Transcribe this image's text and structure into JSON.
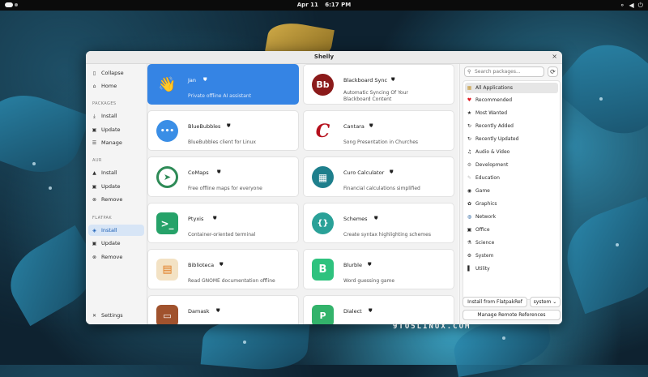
{
  "topbar": {
    "date": "Apr 11",
    "time": "6:17 PM"
  },
  "window": {
    "title": "Shelly",
    "close": "×"
  },
  "sidebar": {
    "collapse": "Collapse",
    "home": "Home",
    "packages_head": "PACKAGES",
    "packages": [
      "Install",
      "Update",
      "Manage"
    ],
    "aur_head": "AUR",
    "aur": [
      "Install",
      "Update",
      "Remove"
    ],
    "flatpak_head": "FLATPAK",
    "flatpak": [
      "Install",
      "Update",
      "Remove"
    ],
    "settings": "Settings"
  },
  "apps": [
    {
      "name": "Jan",
      "desc": "Private offline AI assistant",
      "icon": "waving-hand-icon",
      "color": "#f3c63f"
    },
    {
      "name": "Blackboard Sync",
      "desc": "Automatic Syncing Of Your Blackboard Content",
      "icon": "bb-logo-icon",
      "color": "#2b2b2b"
    },
    {
      "name": "BlueBubbles",
      "desc": "BlueBubbles client for Linux",
      "icon": "chat-bubble-icon",
      "color": "#3a8ee6"
    },
    {
      "name": "Cantara",
      "desc": "Song Presentation in Churches",
      "icon": "letter-c-icon",
      "color": "#d33a2c"
    },
    {
      "name": "CoMaps",
      "desc": "Free offline maps for everyone",
      "icon": "map-pin-icon",
      "color": "#2e8b57"
    },
    {
      "name": "Curo Calculator",
      "desc": "Financial calculations simplified",
      "icon": "calculator-icon",
      "color": "#1e7f8c"
    },
    {
      "name": "Ptyxis",
      "desc": "Container-oriented terminal",
      "icon": "terminal-icon",
      "color": "#26a269"
    },
    {
      "name": "Schemes",
      "desc": "Create syntax highlighting schemes",
      "icon": "braces-icon",
      "color": "#2aa198"
    },
    {
      "name": "Biblioteca",
      "desc": "Read GNOME documentation offline",
      "icon": "book-icon",
      "color": "#e07a1f"
    },
    {
      "name": "Blurble",
      "desc": "Word guessing game",
      "icon": "letter-b-icon",
      "color": "#2ec27e"
    },
    {
      "name": "Damask",
      "desc": "",
      "icon": "image-frame-icon",
      "color": "#a0522d"
    },
    {
      "name": "Dialect",
      "desc": "",
      "icon": "translate-icon",
      "color": "#33b36b"
    }
  ],
  "search": {
    "placeholder": "Search packages...",
    "refresh": "⟳"
  },
  "categories": [
    {
      "label": "All Applications",
      "color": "#c79a3a",
      "glyph": "▦"
    },
    {
      "label": "Recommended",
      "color": "#e01b24",
      "glyph": "♥"
    },
    {
      "label": "Most Wanted",
      "color": "#222222",
      "glyph": "★"
    },
    {
      "label": "Recently Added",
      "color": "#222222",
      "glyph": "↻"
    },
    {
      "label": "Recently Updated",
      "color": "#222222",
      "glyph": "↻"
    },
    {
      "label": "Audio & Video",
      "color": "#222222",
      "glyph": "♫"
    },
    {
      "label": "Development",
      "color": "#555555",
      "glyph": "⚙"
    },
    {
      "label": "Education",
      "color": "#bbbbbb",
      "glyph": "✎"
    },
    {
      "label": "Game",
      "color": "#222222",
      "glyph": "◉"
    },
    {
      "label": "Graphics",
      "color": "#222222",
      "glyph": "✿"
    },
    {
      "label": "Network",
      "color": "#3a6ea5",
      "glyph": "◍"
    },
    {
      "label": "Office",
      "color": "#222222",
      "glyph": "▣"
    },
    {
      "label": "Science",
      "color": "#222222",
      "glyph": "⚗"
    },
    {
      "label": "System",
      "color": "#222222",
      "glyph": "⚙"
    },
    {
      "label": "Utility",
      "color": "#222222",
      "glyph": "▌"
    }
  ],
  "footer": {
    "install_ref": "Install from FlatpakRef",
    "scope": "system",
    "manage_remotes": "Manage Remote References"
  },
  "watermark": "9TO5LINUX.COM"
}
